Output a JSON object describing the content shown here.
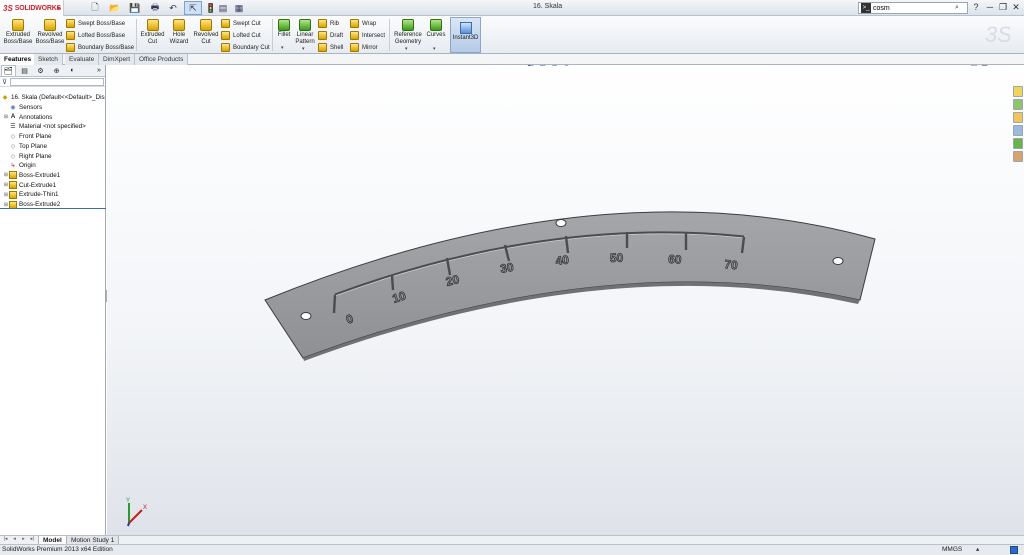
{
  "app": {
    "logo_mark": "3S",
    "logo_text": "SOLIDWORKS",
    "doc_title": "16. Skala"
  },
  "search": {
    "value": "cosm"
  },
  "ribbon": {
    "extruded_boss": "Extruded Boss/Base",
    "revolved_boss": "Revolved Boss/Base",
    "swept_boss": "Swept Boss/Base",
    "lofted_boss": "Lofted Boss/Base",
    "boundary_boss": "Boundary Boss/Base",
    "extruded_cut": "Extruded Cut",
    "hole_wizard": "Hole Wizard",
    "revolved_cut": "Revolved Cut",
    "swept_cut": "Swept Cut",
    "lofted_cut": "Lofted Cut",
    "boundary_cut": "Boundary Cut",
    "fillet": "Fillet",
    "linear_pattern": "Linear Pattern",
    "rib": "Rib",
    "draft": "Draft",
    "shell": "Shell",
    "wrap": "Wrap",
    "intersect": "Intersect",
    "mirror": "Mirror",
    "reference_geometry": "Reference Geometry",
    "curves": "Curves",
    "instant3d": "Instant3D"
  },
  "command_tabs": [
    "Features",
    "Sketch",
    "Evaluate",
    "DimXpert",
    "Office Products"
  ],
  "tree": {
    "root": "16. Skala  (Default<<Default>_Dis",
    "items": [
      "Sensors",
      "Annotations",
      "Material <not specified>",
      "Front Plane",
      "Top Plane",
      "Right Plane",
      "Origin",
      "Boss-Extrude1",
      "Cut-Extrude1",
      "Extrude-Thin1",
      "Boss-Extrude2"
    ]
  },
  "model": {
    "scale_labels": [
      "0",
      "10",
      "20",
      "30",
      "40",
      "50",
      "60",
      "70"
    ]
  },
  "triad": {
    "x": "X",
    "y": "Y"
  },
  "bottom_tabs": [
    "Model",
    "Motion Study 1"
  ],
  "status": {
    "text": "SolidWorks Premium 2013 x64 Edition",
    "units": "MMGS"
  },
  "icons": {
    "win_min": "─",
    "win_restore": "❐",
    "win_close": "✕",
    "help": "?"
  }
}
